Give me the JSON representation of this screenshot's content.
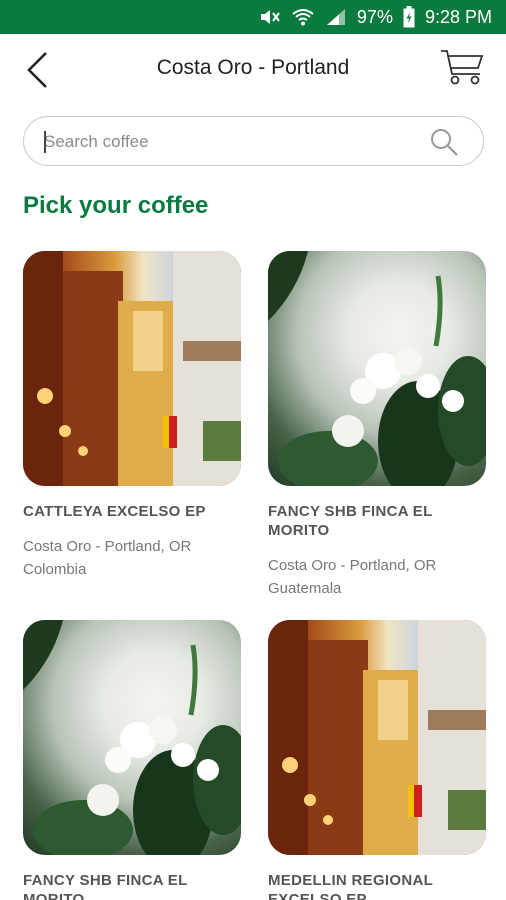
{
  "status_bar": {
    "battery": "97%",
    "time": "9:28 PM"
  },
  "header": {
    "title": "Costa Oro - Portland"
  },
  "search": {
    "placeholder": "Search coffee",
    "value": ""
  },
  "section": {
    "title": "Pick your coffee"
  },
  "colors": {
    "brand_green": "#0b7a3e",
    "status_bar": "#0b7a3e"
  },
  "coffees": [
    {
      "name": "CATTLEYA EXCELSO EP",
      "roaster": "Costa Oro - Portland, OR",
      "origin": "Colombia",
      "image": "street-scene"
    },
    {
      "name": "FANCY SHB FINCA EL MORITO",
      "roaster": "Costa Oro - Portland, OR",
      "origin": "Guatemala",
      "image": "coffee-flowers"
    },
    {
      "name": "FANCY SHB FINCA EL MORITO",
      "roaster": "",
      "origin": "",
      "image": "coffee-flowers"
    },
    {
      "name": "MEDELLIN REGIONAL EXCELSO EP",
      "roaster": "",
      "origin": "",
      "image": "street-scene"
    }
  ]
}
